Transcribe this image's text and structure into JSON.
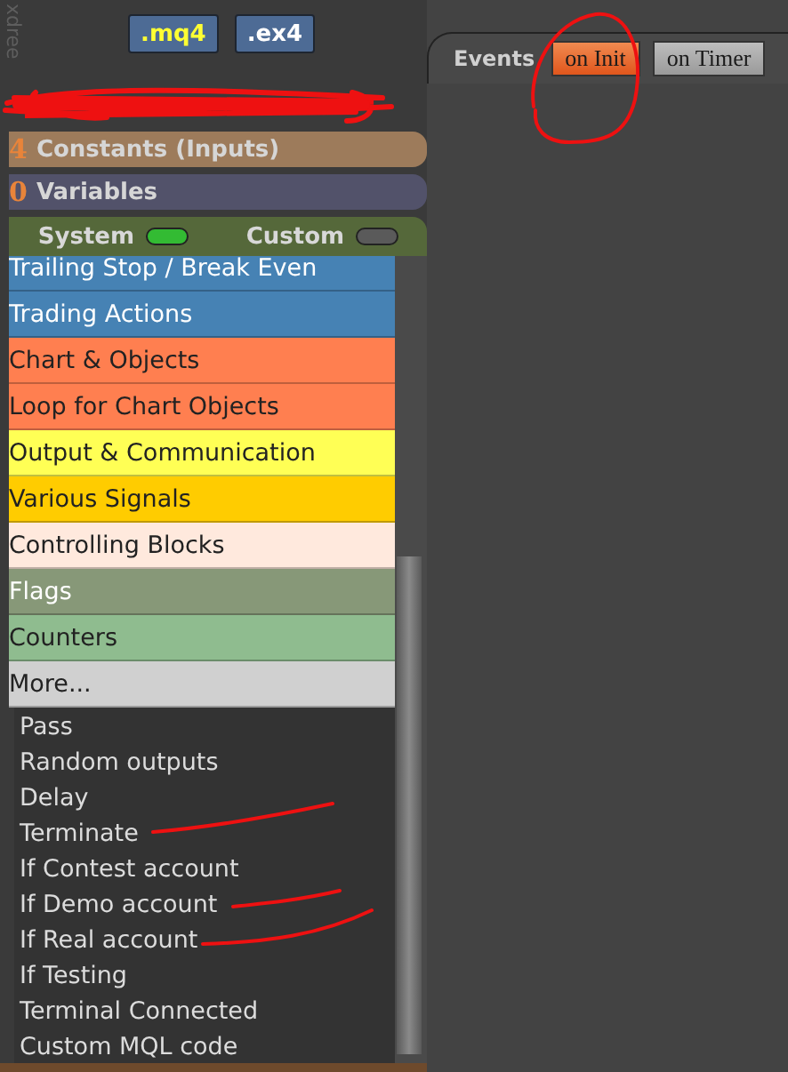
{
  "side_label": "xdree",
  "file_buttons": [
    {
      "label": ".mq4",
      "color": "#ffff33"
    },
    {
      "label": ".ex4",
      "color": "#ffffff"
    }
  ],
  "sections": [
    {
      "count": "4",
      "label": "Constants (Inputs)",
      "color": "#9d7b5b"
    },
    {
      "count": "0",
      "label": "Variables",
      "color": "#52526a"
    }
  ],
  "toggles": [
    {
      "label": "System",
      "on": true
    },
    {
      "label": "Custom",
      "on": false
    }
  ],
  "categories": [
    {
      "label": "Trailing Stop / Break Even",
      "color": "#4682b4"
    },
    {
      "label": "Trading Actions",
      "color": "#4682b4"
    },
    {
      "label": "Chart & Objects",
      "color": "#ff7f50"
    },
    {
      "label": "Loop for Chart Objects",
      "color": "#ff7f50"
    },
    {
      "label": "Output & Communication",
      "color": "#ffff55"
    },
    {
      "label": "Various Signals",
      "color": "#ffcc00"
    },
    {
      "label": "Controlling Blocks",
      "color": "#ffe9dd"
    },
    {
      "label": "Flags",
      "color": "#879878"
    },
    {
      "label": "Counters",
      "color": "#8fbc8f"
    },
    {
      "label": "More...",
      "color": "#d0d0d0"
    }
  ],
  "more_menu": [
    "Pass",
    "Random outputs",
    "Delay",
    "Terminate",
    "If Contest account",
    "If Demo account",
    "If Real account",
    "If Testing",
    "Terminal Connected",
    "Custom MQL code"
  ],
  "events": {
    "label": "Events",
    "tabs": [
      {
        "label": "on Init",
        "selected": true
      },
      {
        "label": "on Timer",
        "selected": false
      }
    ]
  }
}
